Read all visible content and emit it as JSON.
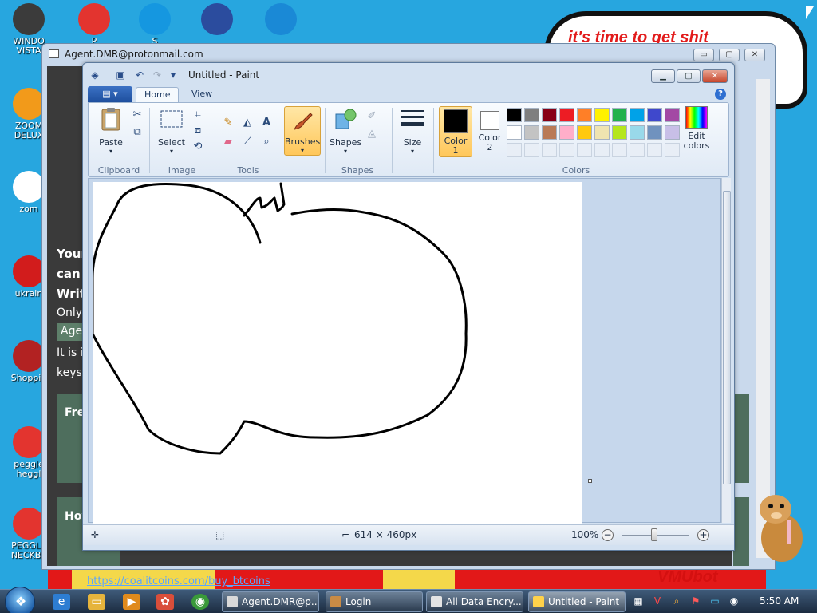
{
  "desktop": {
    "speech_text": "it's time to get shit",
    "banner_text": "VMUbot",
    "icons": [
      {
        "label": "WINDO\nVISTA",
        "icon": "windows-vista-icon",
        "color": "#3b3b3b"
      },
      {
        "label": "P",
        "icon": "peggle-icon",
        "color": "#e3342f"
      },
      {
        "label": "S",
        "icon": "skype-icon",
        "color": "#1597e0"
      },
      {
        "label": "",
        "icon": "globe-icon",
        "color": "#2b4c9e"
      },
      {
        "label": "",
        "icon": "roblox-icon",
        "color": "#1a89d6"
      },
      {
        "label": "ZOOM\nDELUX",
        "icon": "zoom-icon",
        "color": "#f29a1a"
      },
      {
        "label": "zom",
        "icon": "flower-icon",
        "color": "#ffffff"
      },
      {
        "label": "ukrain",
        "icon": "radiation-icon",
        "color": "#d21c1c"
      },
      {
        "label": "Shoppin",
        "icon": "flash-icon",
        "color": "#b22222"
      },
      {
        "label": "peggle\nheggl",
        "icon": "peggle-heggle-icon",
        "color": "#e3342f"
      },
      {
        "label": "PEGGLE\nNECKBE",
        "icon": "peggle-neckbeard-icon",
        "color": "#e3342f"
      }
    ]
  },
  "browser": {
    "title": "Agent.DMR@protonmail.com",
    "lines": [
      "Your",
      "can r",
      "Writ",
      "Only",
      "Agen",
      "It is i",
      "keys"
    ],
    "box1": "Fre",
    "box2": "Hov",
    "link": "https://coalitcoins.com/buy_btcoins",
    "min": "▭",
    "max": "▢",
    "close": "✕"
  },
  "paint": {
    "title": "Untitled - Paint",
    "tabs": {
      "file": "▤ ▾",
      "home": "Home",
      "view": "View"
    },
    "groups": {
      "clipboard": "Clipboard",
      "image": "Image",
      "tools": "Tools",
      "shapes": "Shapes",
      "colors": "Colors"
    },
    "buttons": {
      "paste": "Paste",
      "select": "Select",
      "brushes": "Brushes",
      "shapes": "Shapes",
      "size": "Size",
      "color1": "Color\n1",
      "color2": "Color\n2",
      "edit_colors": "Edit\ncolors"
    },
    "status": {
      "dimensions": "614 × 460px",
      "zoom": "100%"
    },
    "colors": {
      "color1": "#000000",
      "color2": "#ffffff",
      "palette_row1": [
        "#000000",
        "#7f7f7f",
        "#880015",
        "#ed1c24",
        "#ff7f27",
        "#fff200",
        "#22b14c",
        "#00a2e8",
        "#3f48cc",
        "#a349a4"
      ],
      "palette_row2": [
        "#ffffff",
        "#c3c3c3",
        "#b97a57",
        "#ffaec9",
        "#ffc90e",
        "#efe4b0",
        "#b5e61d",
        "#99d9ea",
        "#7092be",
        "#c8bfe7"
      ]
    }
  },
  "taskbar": {
    "tasks": [
      {
        "label": "Agent.DMR@p...",
        "color": "#d9d9d9",
        "active": false
      },
      {
        "label": "Login",
        "color": "#c98b45",
        "active": false
      },
      {
        "label": "All Data Encry...",
        "color": "#e4e4e4",
        "active": false
      },
      {
        "label": "Untitled - Paint",
        "color": "#ffd24a",
        "active": true
      }
    ],
    "clock": "5:50 AM"
  }
}
